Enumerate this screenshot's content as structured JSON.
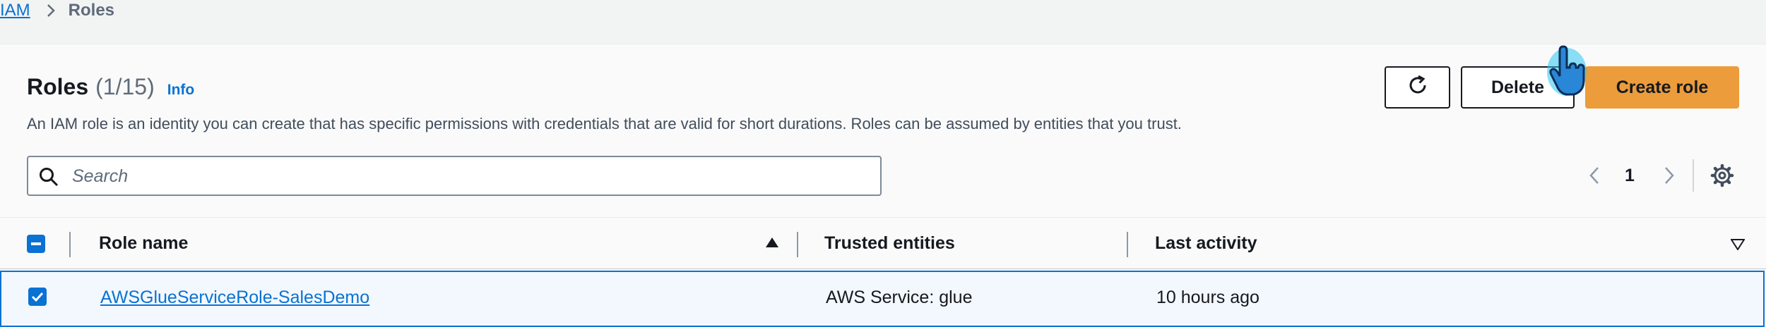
{
  "breadcrumb": {
    "parent": "IAM",
    "current": "Roles"
  },
  "header": {
    "title": "Roles",
    "count": "(1/15)",
    "info": "Info",
    "description": "An IAM role is an identity you can create that has specific permissions with credentials that are valid for short durations. Roles can be assumed by entities that you trust."
  },
  "actions": {
    "refresh_icon": "refresh-icon",
    "delete": "Delete",
    "create": "Create role"
  },
  "search": {
    "placeholder": "Search",
    "value": ""
  },
  "pagination": {
    "page": "1"
  },
  "table": {
    "columns": [
      "Role name",
      "Trusted entities",
      "Last activity"
    ],
    "rows": [
      {
        "selected": true,
        "role_name": "AWSGlueServiceRole-SalesDemo",
        "trusted_entities": "AWS Service: glue",
        "last_activity": "10 hours ago"
      }
    ]
  },
  "colors": {
    "link": "#0972d3",
    "primary": "#ec9c3b",
    "text": "#16191f"
  }
}
